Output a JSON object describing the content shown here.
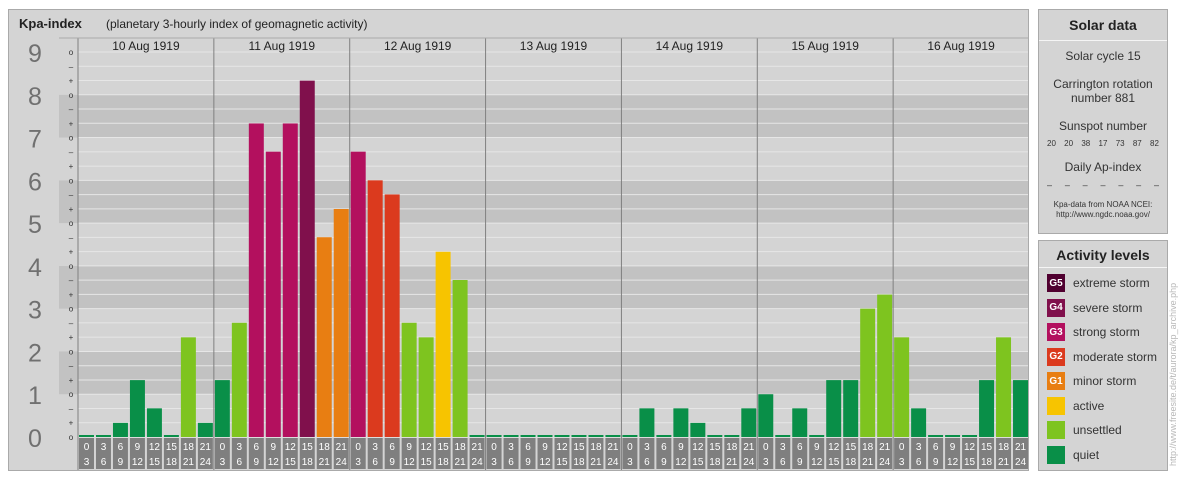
{
  "chart_data": {
    "type": "bar",
    "title": "Kpa-index",
    "subtitle": "(planetary 3-hourly index of geomagnetic activity)",
    "ylim": [
      0,
      9
    ],
    "y_ticks": [
      "0",
      "1",
      "2",
      "3",
      "4",
      "5",
      "6",
      "7",
      "8",
      "9"
    ],
    "y_minor_ticks": [
      "o",
      "+",
      "–"
    ],
    "days": [
      "10 Aug 1919",
      "11 Aug 1919",
      "12 Aug 1919",
      "13 Aug 1919",
      "14 Aug 1919",
      "15 Aug 1919",
      "16 Aug 1919"
    ],
    "interval_start_labels": [
      "0",
      "3",
      "6",
      "9",
      "12",
      "15",
      "18",
      "21"
    ],
    "interval_end_labels": [
      "3",
      "6",
      "9",
      "12",
      "15",
      "18",
      "21",
      "24"
    ],
    "series": [
      {
        "values": [
          0,
          0,
          0.33,
          1.33,
          0.67,
          0,
          2.33,
          0.33
        ]
      },
      {
        "values": [
          1.33,
          2.67,
          7.33,
          6.67,
          7.33,
          8.33,
          4.67,
          5.33
        ]
      },
      {
        "values": [
          6.67,
          6,
          5.67,
          2.67,
          2.33,
          4.33,
          3.67,
          0
        ]
      },
      {
        "values": [
          0,
          0,
          0,
          0,
          0,
          0,
          0,
          0
        ]
      },
      {
        "values": [
          0,
          0.67,
          0,
          0.67,
          0.33,
          0,
          0,
          0.67
        ]
      },
      {
        "values": [
          1,
          0,
          0.67,
          0,
          1.33,
          1.33,
          3,
          3.33
        ]
      },
      {
        "values": [
          2.33,
          0.67,
          0,
          0,
          0,
          1.33,
          2.33,
          1.33
        ]
      }
    ],
    "grid": true
  },
  "colors": {
    "panel_bg": "#d4d4d4",
    "band_dark": "#c2c2c2",
    "gridline": "#e6e6e6",
    "tick_box": "#7f7f7f",
    "tick_text": "#ffffff",
    "quiet": "#098f48",
    "unsettled": "#7ec41f",
    "active": "#f7c400",
    "minor": "#e87e12",
    "moderate": "#db3a1e",
    "strong": "#b3105e",
    "severe": "#80104c",
    "extreme": "#500030"
  },
  "solar": {
    "heading": "Solar data",
    "cycle": "Solar cycle 15",
    "carrington_line1": "Carrington rotation",
    "carrington_line2": "number 881",
    "sunspot_heading": "Sunspot number",
    "sunspot_values": [
      "20",
      "20",
      "38",
      "17",
      "73",
      "87",
      "82"
    ],
    "ap_heading": "Daily Ap-index",
    "ap_values": [
      "–",
      "–",
      "–",
      "–",
      "–",
      "–",
      "–"
    ],
    "credit_line1": "Kpa-data from NOAA NCEI:",
    "credit_line2": "http://www.ngdc.noaa.gov/"
  },
  "legend": {
    "heading": "Activity levels",
    "items": [
      {
        "badge": "G5",
        "label": "extreme storm",
        "color": "#500030"
      },
      {
        "badge": "G4",
        "label": "severe storm",
        "color": "#80104c"
      },
      {
        "badge": "G3",
        "label": "strong storm",
        "color": "#b3105e"
      },
      {
        "badge": "G2",
        "label": "moderate storm",
        "color": "#db3a1e"
      },
      {
        "badge": "G1",
        "label": "minor storm",
        "color": "#e87e12"
      },
      {
        "badge": "",
        "label": "active",
        "color": "#f7c400"
      },
      {
        "badge": "",
        "label": "unsettled",
        "color": "#7ec41f"
      },
      {
        "badge": "",
        "label": "quiet",
        "color": "#098f48"
      }
    ]
  },
  "side_url": "http://www.freesite.de/t/aurora/kp_archive.php"
}
